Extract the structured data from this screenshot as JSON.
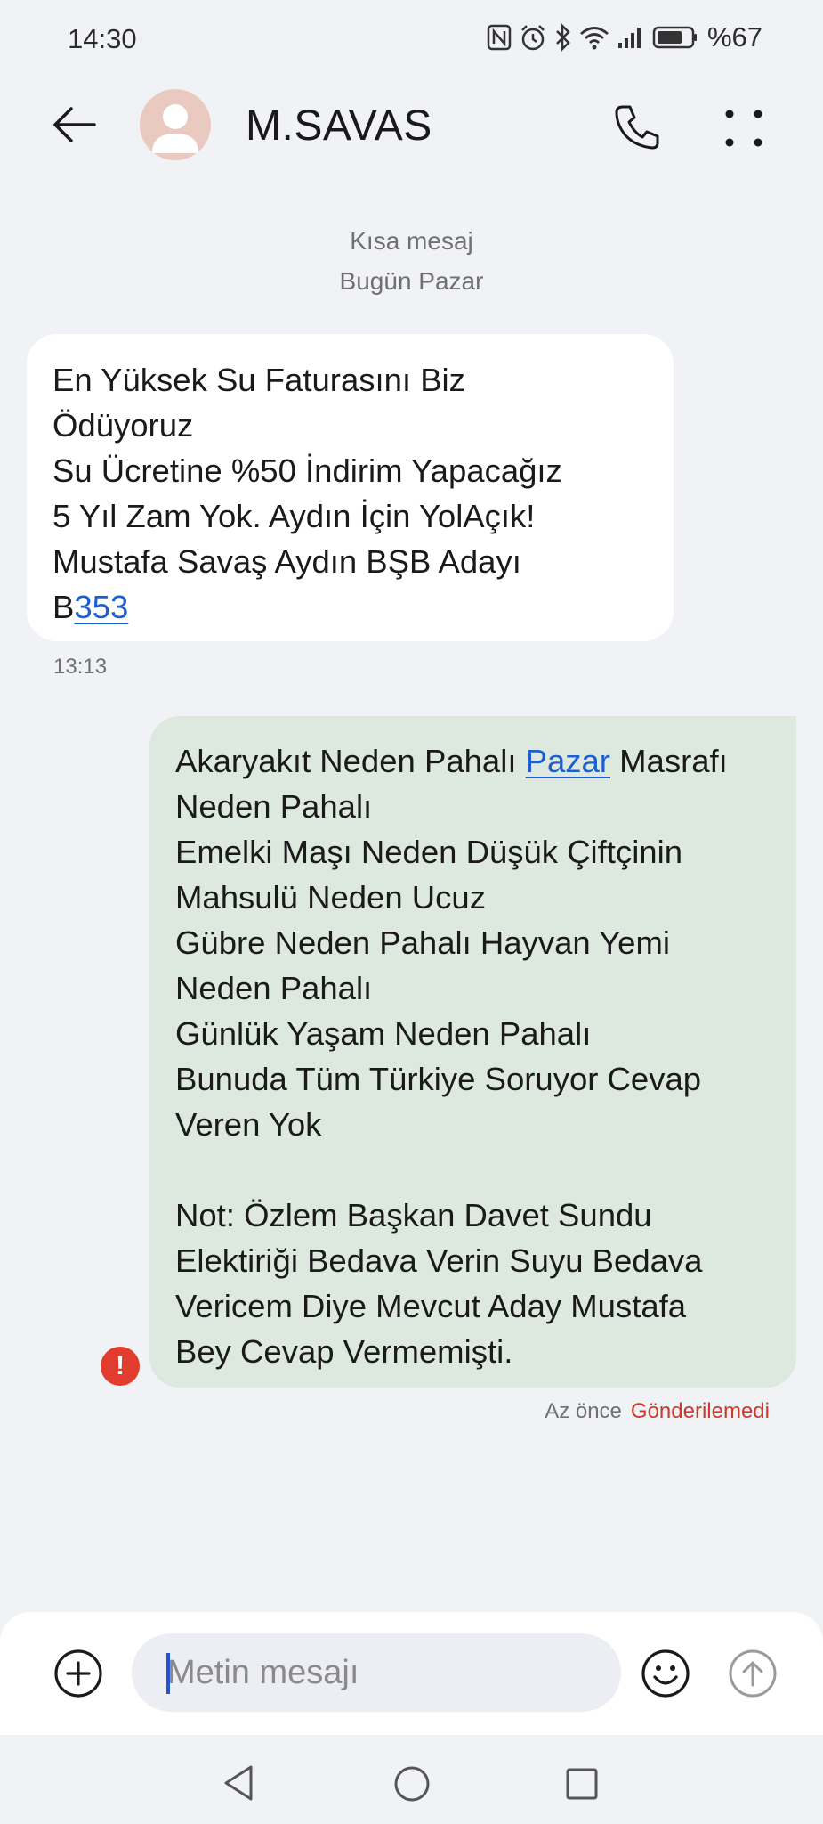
{
  "status_bar": {
    "time": "14:30",
    "battery": "%67",
    "icons": [
      "nfc-icon",
      "alarm-icon",
      "bluetooth-icon",
      "wifi-icon",
      "signal-icon",
      "battery-icon"
    ]
  },
  "header": {
    "contact_name": "M.SAVAS",
    "icons": [
      "back-arrow-icon",
      "avatar-icon",
      "phone-icon",
      "more-dots-icon"
    ]
  },
  "thread": {
    "message_type": "Kısa mesaj",
    "day": "Bugün Pazar"
  },
  "incoming": {
    "lines": [
      "En Yüksek Su Faturasını Biz",
      "Ödüyoruz",
      "Su Ücretine %50 İndirim Yapacağız",
      "5 Yıl Zam Yok. Aydın İçin YolAçık!",
      "Mustafa Savaş Aydın BŞB Adayı"
    ],
    "last_prefix": "B",
    "last_link": "353",
    "time": "13:13"
  },
  "outgoing": {
    "line1_before": "Akaryakıt Neden Pahalı ",
    "line1_link": "Pazar",
    "line1_after": " Masrafı",
    "lines": [
      "Neden Pahalı",
      "Emelki Maşı Neden Düşük Çiftçinin",
      "Mahsulü Neden Ucuz",
      "Gübre Neden Pahalı Hayvan Yemi",
      "Neden Pahalı",
      "Günlük Yaşam Neden Pahalı",
      "Bunuda Tüm Türkiye Soruyor Cevap",
      "Veren Yok",
      "",
      "Not: Özlem Başkan Davet Sundu",
      "Elektiriği Bedava Verin Suyu Bedava",
      "Vericem Diye Mevcut Aday Mustafa",
      "Bey Cevap Vermemişti."
    ],
    "error_mark": "!",
    "time": "Az önce",
    "status": "Gönderilemedi"
  },
  "composer": {
    "placeholder": "Metin mesajı",
    "icons": [
      "add-icon",
      "emoji-icon",
      "send-icon"
    ]
  },
  "nav": {
    "icons": [
      "nav-back-icon",
      "nav-home-icon",
      "nav-recents-icon"
    ]
  },
  "colors": {
    "background": "#f1f2f6",
    "incoming_bubble": "#ffffff",
    "outgoing_bubble": "#dde9df",
    "link": "#1d5fd1",
    "error": "#e13c2d"
  }
}
